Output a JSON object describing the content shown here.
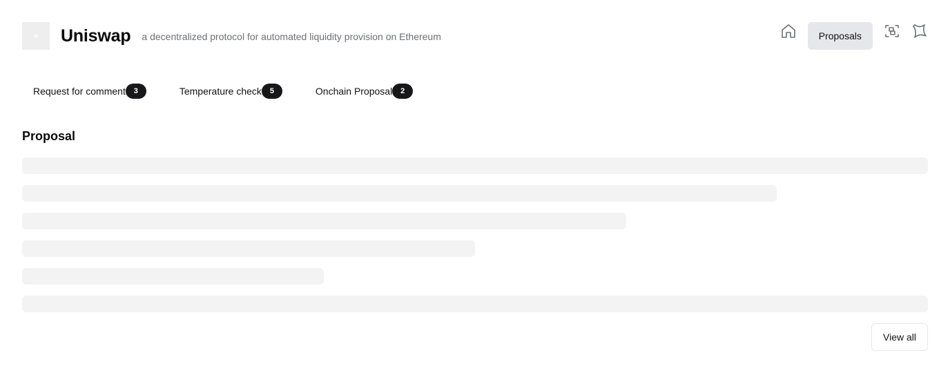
{
  "header": {
    "title": "Uniswap",
    "description": "a decentralized protocol for automated liquidity provision on Ethereum",
    "proposals_label": "Proposals",
    "icons": [
      "home-icon",
      "scan-icon",
      "wallet-icon"
    ]
  },
  "tabs": [
    {
      "label": "Request for comment",
      "count": "3"
    },
    {
      "label": "Temperature check",
      "count": "5"
    },
    {
      "label": "Onchain Proposal",
      "count": "2"
    }
  ],
  "section": {
    "title": "Proposal"
  },
  "footer": {
    "view_all_label": "View all"
  },
  "colors": {
    "badge_bg": "#18181b",
    "active_button_bg": "#e5e7eb",
    "skeleton": "#f3f3f3",
    "muted_text": "#6b6f76"
  }
}
